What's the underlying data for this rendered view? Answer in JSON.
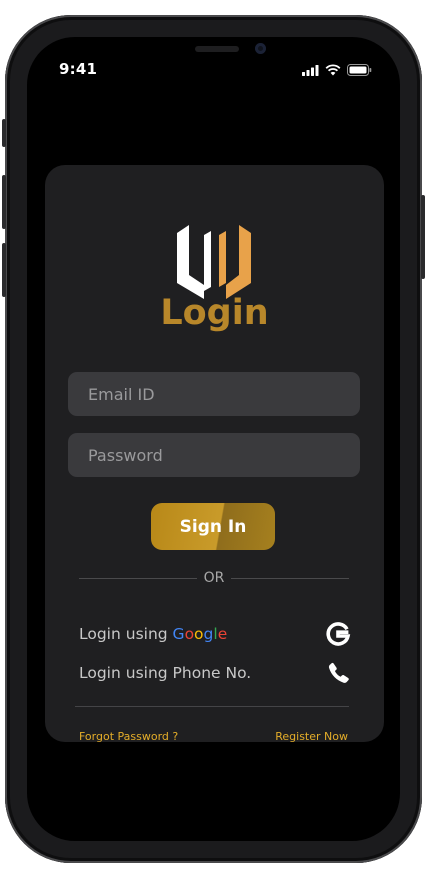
{
  "status_bar": {
    "time": "9:41"
  },
  "login": {
    "title": "Login",
    "email_placeholder": "Email ID",
    "password_placeholder": "Password",
    "sign_in_label": "Sign In",
    "or_text": "OR",
    "google_prefix": "Login using ",
    "google_word": [
      "G",
      "o",
      "o",
      "g",
      "l",
      "e"
    ],
    "phone_label": "Login using Phone No.",
    "forgot_password": "Forgot Password ?",
    "register": "Register Now"
  },
  "icons": [
    "logo-icon",
    "google-icon",
    "phone-icon",
    "signal-icon",
    "wifi-icon",
    "battery-icon"
  ],
  "colors": {
    "accent": "#b8872a",
    "link": "#e4ad29",
    "card": "#1f1f21",
    "field": "#3a3a3d"
  }
}
